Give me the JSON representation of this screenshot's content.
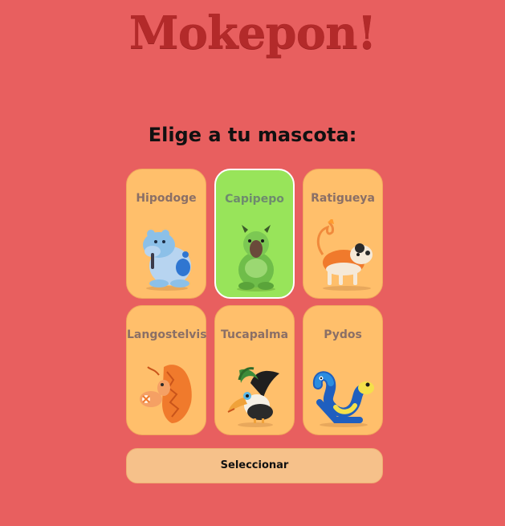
{
  "header": {
    "title": "Mokepon!"
  },
  "selection": {
    "prompt": "Elige a tu mascota:"
  },
  "pets": [
    {
      "name": "Hipodoge",
      "icon": "hipodoge-icon",
      "selected": false
    },
    {
      "name": "Capipepo",
      "icon": "capipepo-icon",
      "selected": true
    },
    {
      "name": "Ratigueya",
      "icon": "ratigueya-icon",
      "selected": false
    },
    {
      "name": "Langostelvis",
      "icon": "langostelvis-icon",
      "selected": false
    },
    {
      "name": "Tucapalma",
      "icon": "tucapalma-icon",
      "selected": false
    },
    {
      "name": "Pydos",
      "icon": "pydos-icon",
      "selected": false
    }
  ],
  "actions": {
    "select_label": "Seleccionar"
  },
  "colors": {
    "background": "#e85f5f",
    "title": "#b32a2a",
    "card": "#ffbf6b",
    "card_selected": "#98e45a",
    "button": "#f6c18a"
  }
}
